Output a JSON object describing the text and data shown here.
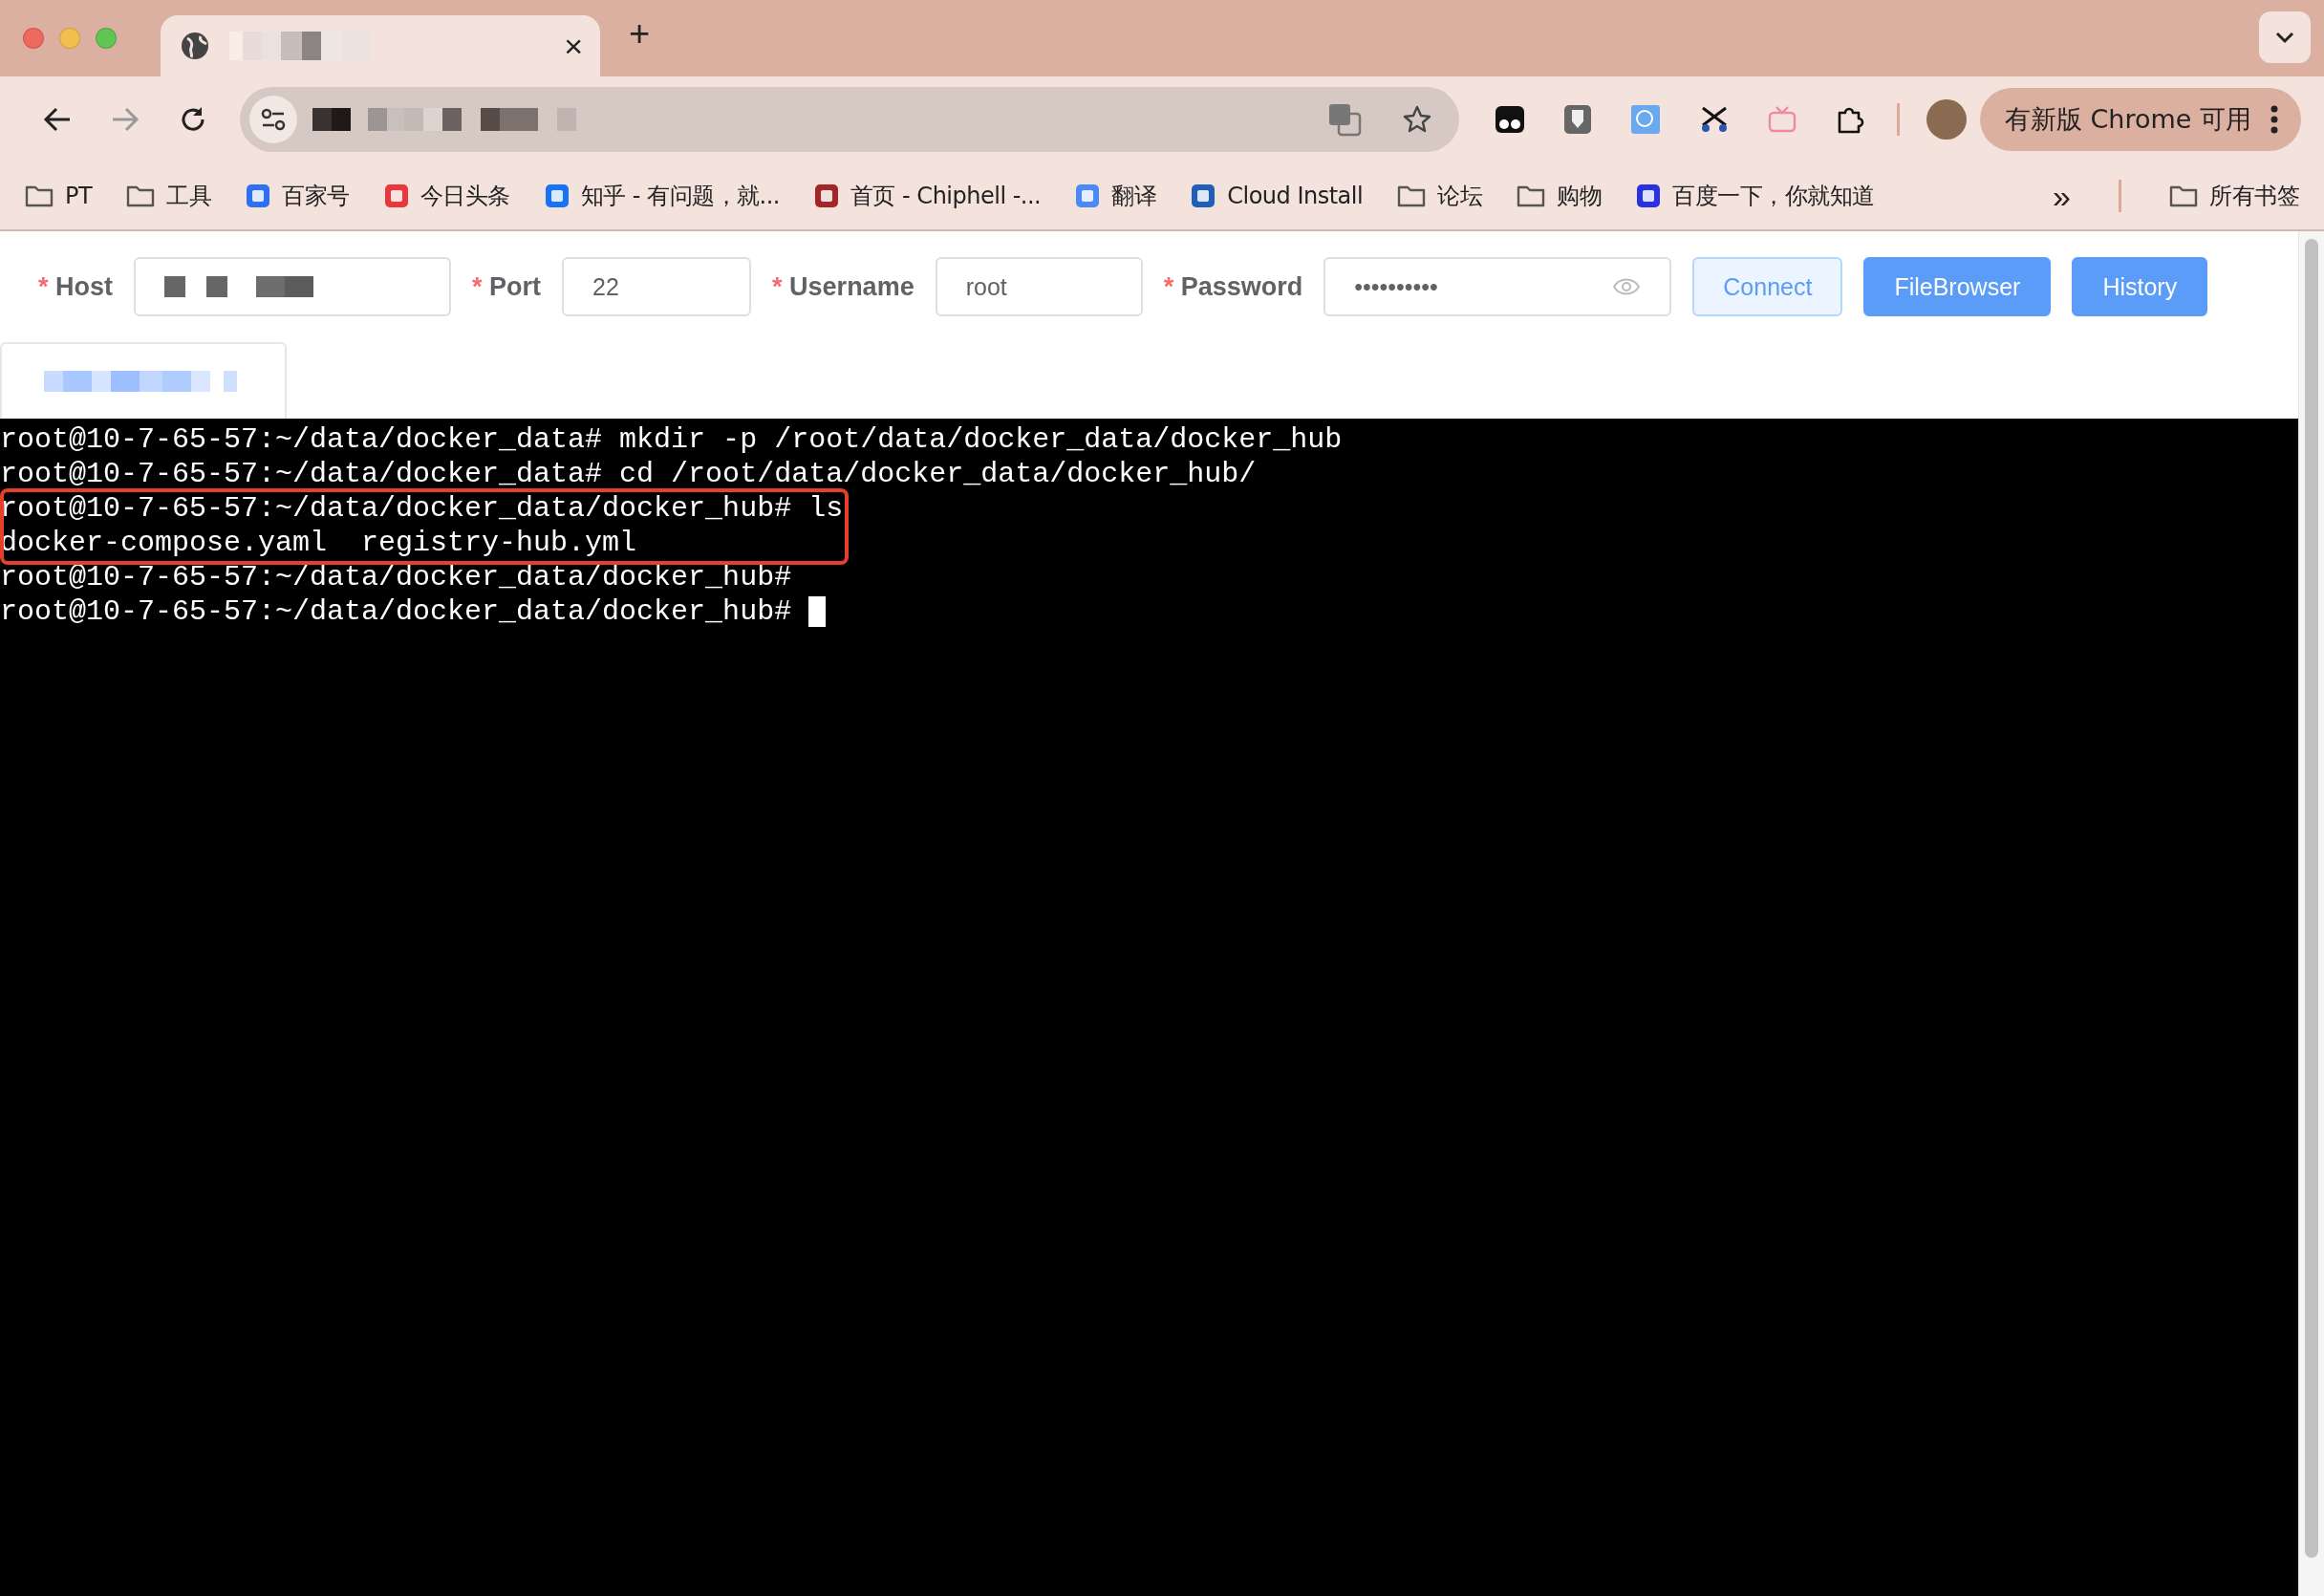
{
  "browser": {
    "tab": {
      "close": "×"
    },
    "new_tab": "+",
    "update_button": "有新版 Chrome 可用",
    "bookmarks": [
      {
        "kind": "folder",
        "label": "PT"
      },
      {
        "kind": "folder",
        "label": "工具"
      },
      {
        "kind": "site",
        "label": "百家号",
        "color": "#2f6ff2"
      },
      {
        "kind": "site",
        "label": "今日头条",
        "color": "#e8383d"
      },
      {
        "kind": "site",
        "label": "知乎 - 有问题，就...",
        "color": "#1772f6"
      },
      {
        "kind": "site",
        "label": "首页 - Chiphell -...",
        "color": "#a3262b"
      },
      {
        "kind": "site",
        "label": "翻译",
        "color": "#4a8af4"
      },
      {
        "kind": "site",
        "label": "Cloud Install",
        "color": "#1f5fb8"
      },
      {
        "kind": "folder",
        "label": "论坛"
      },
      {
        "kind": "folder",
        "label": "购物"
      },
      {
        "kind": "site",
        "label": "百度一下，你就知道",
        "color": "#2932e1"
      }
    ],
    "more": "»",
    "all_bookmarks": "所有书签"
  },
  "form": {
    "fields": [
      {
        "label": "Host",
        "required_mark": "*"
      },
      {
        "label": "Port",
        "required_mark": "*",
        "value": "22"
      },
      {
        "label": "Username",
        "required_mark": "*",
        "value": "root"
      },
      {
        "label": "Password",
        "required_mark": "*",
        "value": "••••••••••",
        "kind": "password"
      }
    ],
    "buttons": [
      {
        "label": "Connect",
        "kind": "plain"
      },
      {
        "label": "FileBrowser",
        "kind": "primary"
      },
      {
        "label": "History",
        "kind": "primary"
      }
    ]
  },
  "terminal": {
    "lines": [
      {
        "text": "root@10-7-65-57:~/data/docker_data# mkdir -p /root/data/docker_data/docker_hub",
        "highlighted": false
      },
      {
        "text": "root@10-7-65-57:~/data/docker_data# cd /root/data/docker_data/docker_hub/",
        "highlighted": false
      },
      {
        "text": "root@10-7-65-57:~/data/docker_data/docker_hub# ls",
        "highlighted": true
      },
      {
        "text": "docker-compose.yaml  registry-hub.yml",
        "highlighted": true
      },
      {
        "text": "root@10-7-65-57:~/data/docker_data/docker_hub#",
        "highlighted": false
      },
      {
        "text": "root@10-7-65-57:~/data/docker_data/docker_hub#",
        "highlighted": false,
        "cursor": true
      }
    ]
  }
}
